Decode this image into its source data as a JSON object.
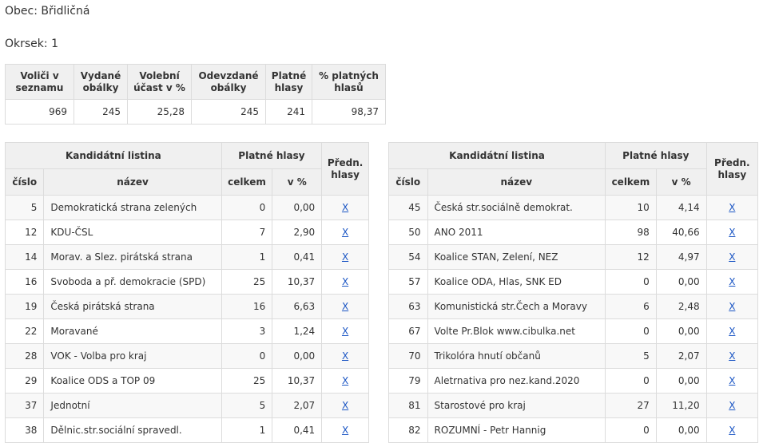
{
  "obec_label": "Obec: Břidličná",
  "okrsek_label": "Okrsek: 1",
  "summary": {
    "headers": [
      "Voliči v seznamu",
      "Vydané obálky",
      "Volební účast v %",
      "Odevzdané obálky",
      "Platné hlasy",
      "% platných hlasů"
    ],
    "values": [
      "969",
      "245",
      "25,28",
      "245",
      "241",
      "98,37"
    ]
  },
  "candidate_headers": {
    "listina": "Kandidátní listina",
    "platne": "Platné hlasy",
    "predn": "Předn. hlasy",
    "cislo": "číslo",
    "nazev": "název",
    "celkem": "celkem",
    "vpct": "v %"
  },
  "x_label": "X",
  "left_rows": [
    {
      "cislo": "5",
      "nazev": "Demokratická strana zelených",
      "celkem": "0",
      "pct": "0,00"
    },
    {
      "cislo": "12",
      "nazev": "KDU-ČSL",
      "celkem": "7",
      "pct": "2,90"
    },
    {
      "cislo": "14",
      "nazev": "Morav. a Slez. pirátská strana",
      "celkem": "1",
      "pct": "0,41"
    },
    {
      "cislo": "16",
      "nazev": "Svoboda a př. demokracie (SPD)",
      "celkem": "25",
      "pct": "10,37"
    },
    {
      "cislo": "19",
      "nazev": "Česká pirátská strana",
      "celkem": "16",
      "pct": "6,63"
    },
    {
      "cislo": "22",
      "nazev": "Moravané",
      "celkem": "3",
      "pct": "1,24"
    },
    {
      "cislo": "28",
      "nazev": "VOK - Volba pro kraj",
      "celkem": "0",
      "pct": "0,00"
    },
    {
      "cislo": "29",
      "nazev": "Koalice ODS a TOP 09",
      "celkem": "25",
      "pct": "10,37"
    },
    {
      "cislo": "37",
      "nazev": "Jednotní",
      "celkem": "5",
      "pct": "2,07"
    },
    {
      "cislo": "38",
      "nazev": "Dělnic.str.sociální spravedl.",
      "celkem": "1",
      "pct": "0,41"
    }
  ],
  "right_rows": [
    {
      "cislo": "45",
      "nazev": "Česká str.sociálně demokrat.",
      "celkem": "10",
      "pct": "4,14"
    },
    {
      "cislo": "50",
      "nazev": "ANO 2011",
      "celkem": "98",
      "pct": "40,66"
    },
    {
      "cislo": "54",
      "nazev": "Koalice STAN, Zelení, NEZ",
      "celkem": "12",
      "pct": "4,97"
    },
    {
      "cislo": "57",
      "nazev": "Koalice ODA, Hlas, SNK ED",
      "celkem": "0",
      "pct": "0,00"
    },
    {
      "cislo": "63",
      "nazev": "Komunistická str.Čech a Moravy",
      "celkem": "6",
      "pct": "2,48"
    },
    {
      "cislo": "67",
      "nazev": "Volte Pr.Blok www.cibulka.net",
      "celkem": "0",
      "pct": "0,00"
    },
    {
      "cislo": "70",
      "nazev": "Trikolóra hnutí občanů",
      "celkem": "5",
      "pct": "2,07"
    },
    {
      "cislo": "79",
      "nazev": "Aletrnativa pro nez.kand.2020",
      "celkem": "0",
      "pct": "0,00"
    },
    {
      "cislo": "81",
      "nazev": "Starostové pro kraj",
      "celkem": "27",
      "pct": "11,20"
    },
    {
      "cislo": "82",
      "nazev": "ROZUMNÍ - Petr Hannig",
      "celkem": "0",
      "pct": "0,00"
    }
  ]
}
